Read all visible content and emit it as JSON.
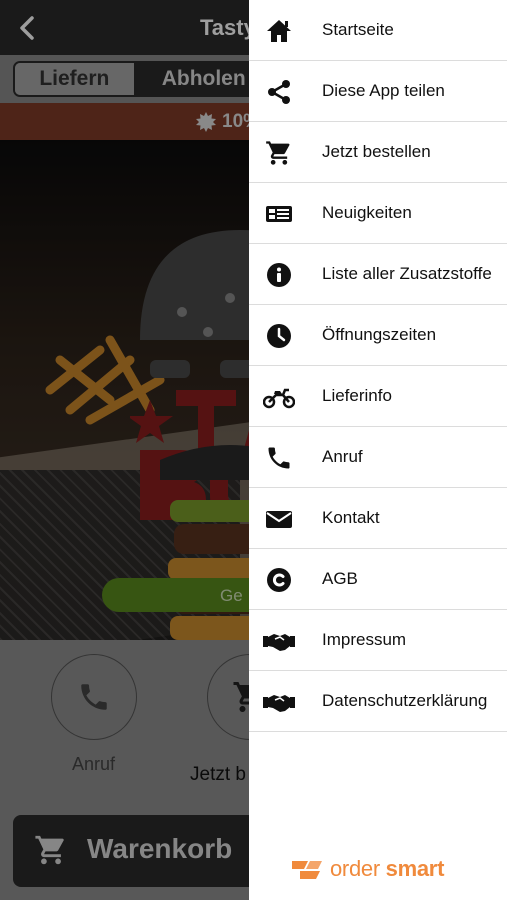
{
  "header": {
    "title": "Tasty"
  },
  "delivery_toggle": {
    "options": [
      "Liefern",
      "Abholen"
    ],
    "selected": "Abholen"
  },
  "promo": {
    "text": "10%"
  },
  "hero": {
    "button_label": "Ge"
  },
  "actions": {
    "call_label": "Anruf",
    "order_label": "Jetzt b"
  },
  "cart": {
    "label": "Warenkorb"
  },
  "menu": {
    "items": [
      {
        "label": "Startseite",
        "icon": "home-icon"
      },
      {
        "label": "Diese App teilen",
        "icon": "share-icon"
      },
      {
        "label": "Jetzt bestellen",
        "icon": "cart-icon"
      },
      {
        "label": "Neuigkeiten",
        "icon": "news-icon"
      },
      {
        "label": "Liste aller Zusatzstoffe",
        "icon": "info-icon"
      },
      {
        "label": "Öffnungszeiten",
        "icon": "clock-icon"
      },
      {
        "label": "Lieferinfo",
        "icon": "motorcycle-icon"
      },
      {
        "label": "Anruf",
        "icon": "phone-icon"
      },
      {
        "label": "Kontakt",
        "icon": "envelope-icon"
      },
      {
        "label": "AGB",
        "icon": "copyright-icon"
      },
      {
        "label": "Impressum",
        "icon": "handshake-icon"
      },
      {
        "label": "Datenschutzerklärung",
        "icon": "handshake-icon"
      }
    ]
  },
  "brand": {
    "word1": "order",
    "word2": "smart",
    "color": "#F08A3C"
  },
  "colors": {
    "topbar": "#2B2B2B",
    "promo": "#C0533A",
    "accent_green": "#7FC32A"
  }
}
